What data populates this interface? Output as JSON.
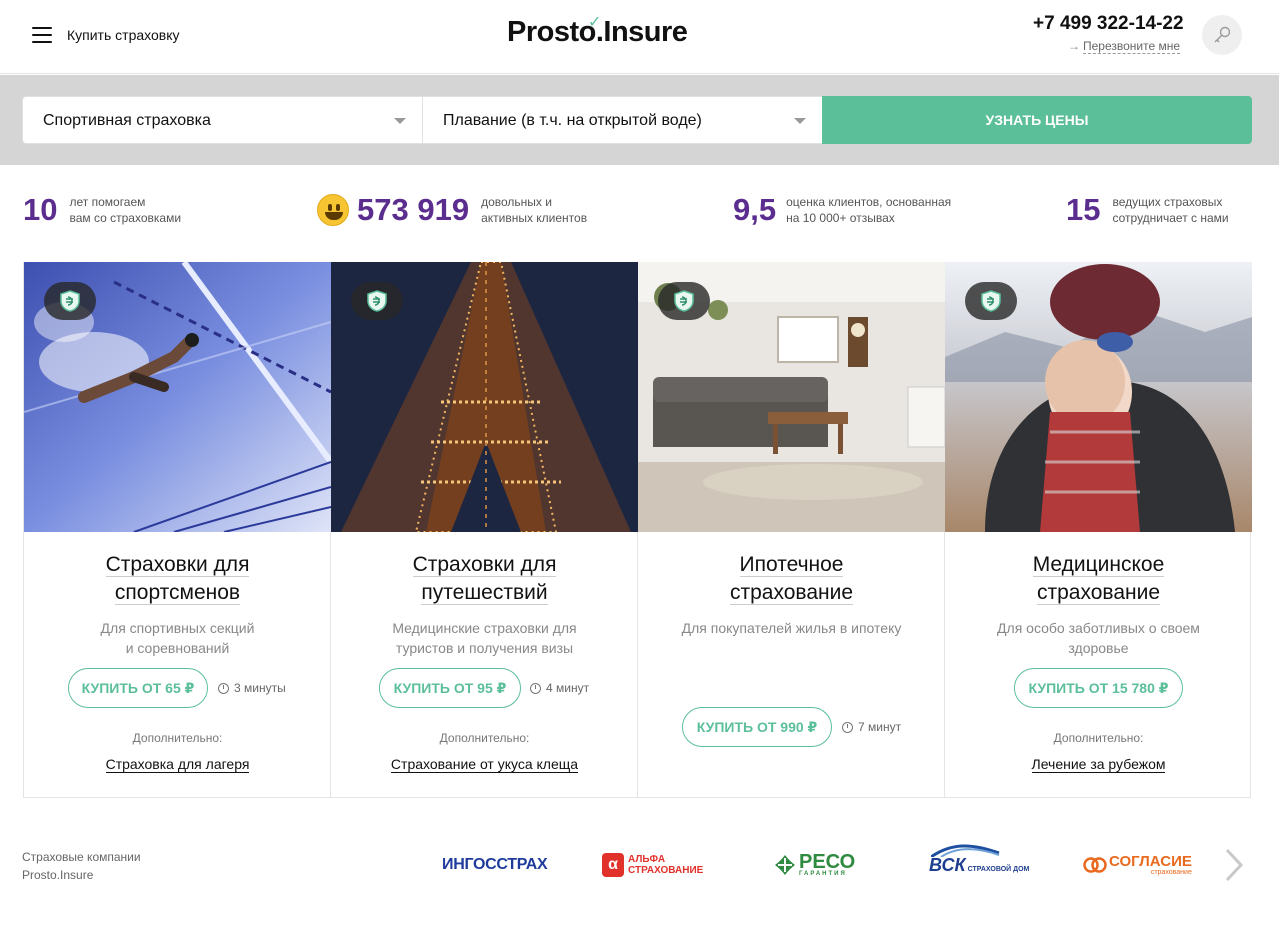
{
  "header": {
    "menu_label": "Купить страховку",
    "logo_text": "Prosto.Insure",
    "phone": "+7 499 322-14-22",
    "callback_label": "Перезвоните мне"
  },
  "search": {
    "category_value": "Спортивная страховка",
    "sport_value": "Плавание (в т.ч. на открытой воде)",
    "submit_label": "УЗНАТЬ ЦЕНЫ"
  },
  "stats": [
    {
      "value": "10",
      "text1": "лет помогаем",
      "text2": "вам со страховками"
    },
    {
      "value": "573 919",
      "text1": "довольных и",
      "text2": "активных клиентов"
    },
    {
      "value": "9,5",
      "text1": "оценка клиентов, основанная",
      "text2": "на 10 000+ отзывах"
    },
    {
      "value": "15",
      "text1": "ведущих страховых",
      "text2": "сотрудничает с нами"
    }
  ],
  "cards": [
    {
      "title1": "Страховки для",
      "title2": "спортсменов",
      "sub1": "Для спортивных секций",
      "sub2": "и соревнований",
      "buy": "КУПИТЬ ОТ 65 ₽",
      "time": "3 минуты",
      "extra_label": "Дополнительно:",
      "extra_link": "Страховка для лагеря"
    },
    {
      "title1": "Страховки для",
      "title2": "путешествий",
      "sub1": "Медицинские страховки для",
      "sub2": "туристов и получения визы",
      "buy": "КУПИТЬ ОТ 95 ₽",
      "time": "4 минут",
      "extra_label": "Дополнительно:",
      "extra_link": "Страхование от укуса клеща"
    },
    {
      "title1": "Ипотечное",
      "title2": "страхование",
      "sub1": "Для покупателей жилья в ипотеку",
      "sub2": "",
      "buy": "КУПИТЬ ОТ 990 ₽",
      "time": "7 минут",
      "extra_label": "",
      "extra_link": ""
    },
    {
      "title1": "Медицинское",
      "title2": "страхование",
      "sub1": "Для особо заботливых о своем",
      "sub2": "здоровье",
      "buy": "КУПИТЬ ОТ 15 780 ₽",
      "time": "",
      "extra_label": "Дополнительно:",
      "extra_link": "Лечение за рубежом"
    }
  ],
  "partners": {
    "label1": "Страховые компании",
    "label2": "Prosto.Insure",
    "logos": [
      "ИНГОССТРАХ",
      "АЛЬФА",
      "СТРАХОВАНИЕ",
      "РЕСО",
      "ГАРАНТИЯ",
      "ВСК",
      "СТРАХОВОЙ ДОМ",
      "СОГЛАСИЕ",
      "страхование"
    ]
  },
  "colors": {
    "accent": "#5bbf9a",
    "stat_purple": "#5b2d8e",
    "band": "#d5d5d5"
  }
}
